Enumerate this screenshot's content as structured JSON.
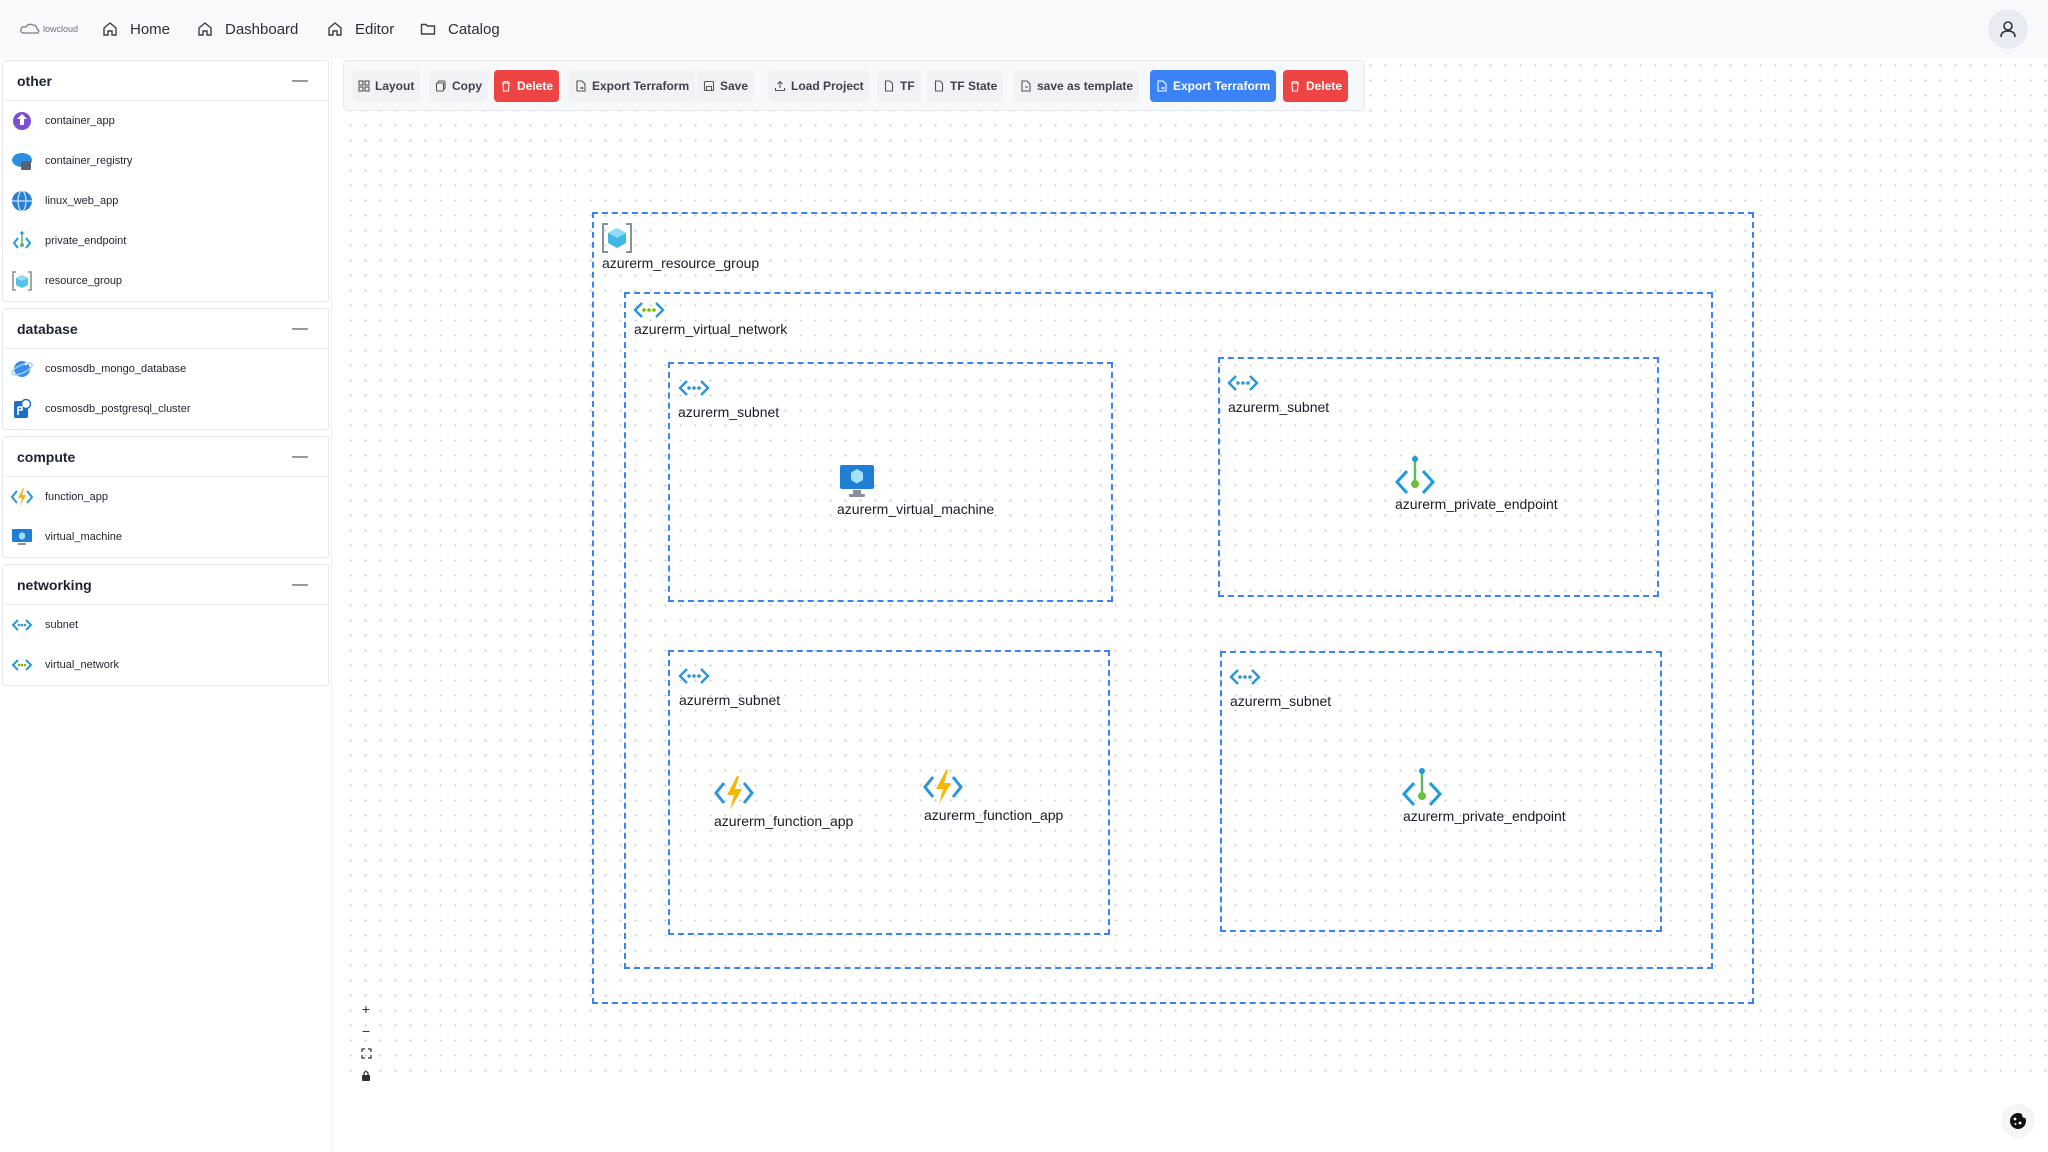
{
  "brand": {
    "logo_text": "lowcloud"
  },
  "nav": [
    {
      "label": "Home",
      "icon": "home-icon"
    },
    {
      "label": "Dashboard",
      "icon": "home-icon"
    },
    {
      "label": "Editor",
      "icon": "home-icon"
    },
    {
      "label": "Catalog",
      "icon": "folder-icon"
    }
  ],
  "sidebar": {
    "sections": [
      {
        "title": "other",
        "items": [
          "container_app",
          "container_registry",
          "linux_web_app",
          "private_endpoint",
          "resource_group"
        ]
      },
      {
        "title": "database",
        "items": [
          "cosmosdb_mongo_database",
          "cosmosdb_postgresql_cluster"
        ]
      },
      {
        "title": "compute",
        "items": [
          "function_app",
          "virtual_machine"
        ]
      },
      {
        "title": "networking",
        "items": [
          "subnet",
          "virtual_network"
        ]
      }
    ]
  },
  "toolbar": {
    "layout": "Layout",
    "copy": "Copy",
    "delete": "Delete",
    "export_terraform": "Export Terraform",
    "save": "Save",
    "load_project": "Load Project",
    "tf": "TF",
    "tf_state": "TF State",
    "save_as_template": "save as template",
    "export_terraform_primary": "Export Terraform",
    "delete_secondary": "Delete"
  },
  "diagram": {
    "resource_group": "azurerm_resource_group",
    "virtual_network": "azurerm_virtual_network",
    "subnet_1": "azurerm_subnet",
    "subnet_2": "azurerm_subnet",
    "subnet_3": "azurerm_subnet",
    "subnet_4": "azurerm_subnet",
    "virtual_machine": "azurerm_virtual_machine",
    "private_endpoint_1": "azurerm_private_endpoint",
    "private_endpoint_2": "azurerm_private_endpoint",
    "function_app_1": "azurerm_function_app",
    "function_app_2": "azurerm_function_app"
  },
  "zoom_controls": {
    "zoom_in": "+",
    "zoom_out": "−"
  },
  "colors": {
    "accent": "#3b82f6",
    "danger": "#ef4444",
    "group_border": "#3b82f6"
  }
}
